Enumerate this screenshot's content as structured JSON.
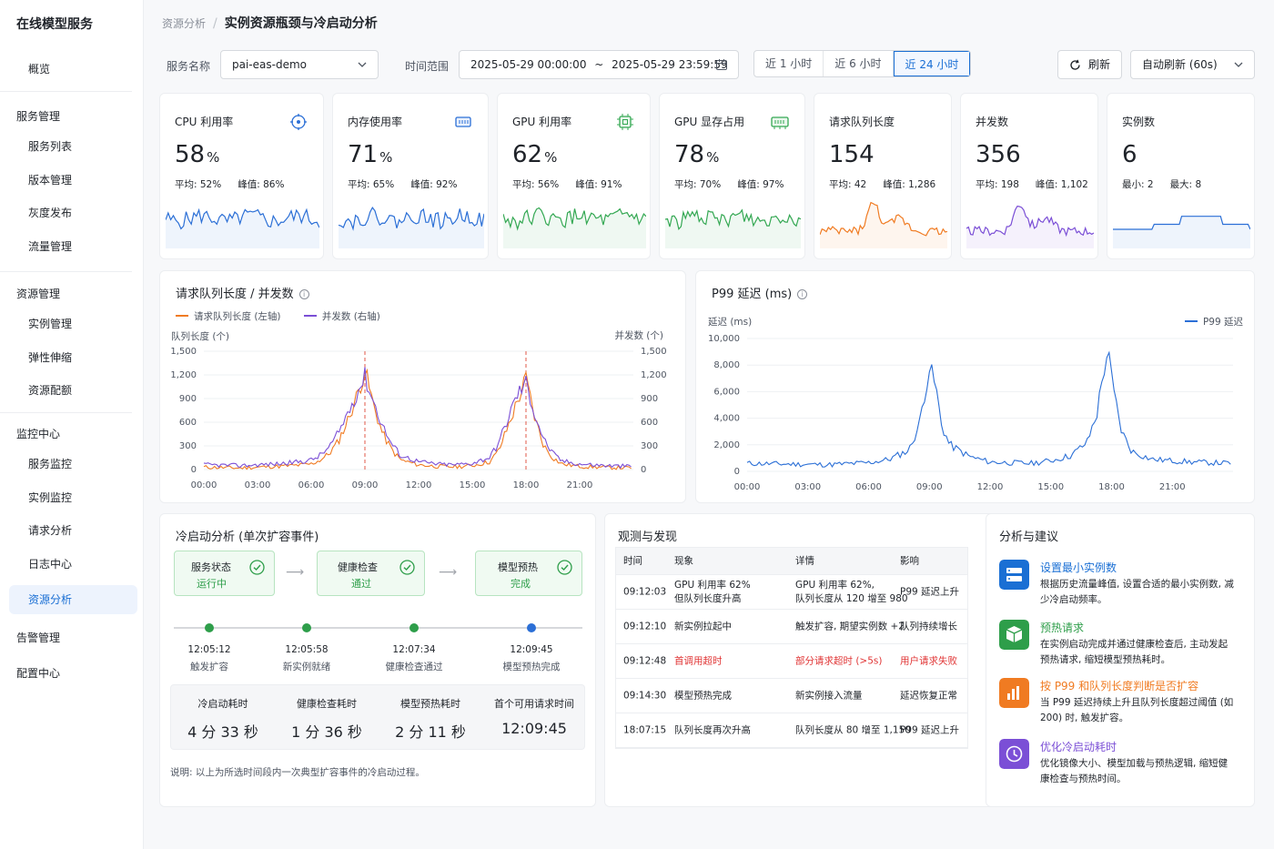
{
  "app": {
    "title": "在线模型服务"
  },
  "nav": {
    "overview": "概览",
    "g1": "服务管理",
    "g1_items": [
      "服务列表",
      "版本管理",
      "灰度发布",
      "流量管理"
    ],
    "g2": "资源管理",
    "g2_items": [
      "实例管理",
      "弹性伸缩",
      "资源配额"
    ],
    "g3": "监控中心",
    "g3_items": [
      "服务监控",
      "实例监控",
      "请求分析",
      "日志中心",
      "资源分析"
    ],
    "g4": "告警管理",
    "g5": "配置中心"
  },
  "breadcrumb": {
    "parent": "资源分析",
    "sep": "/",
    "current": "实例资源瓶颈与冷启动分析"
  },
  "filters": {
    "service_label": "服务名称",
    "service_value": "pai-eas-demo",
    "time_label": "时间范围",
    "time_start": "2025-05-29 00:00:00",
    "time_sep": "~",
    "time_end": "2025-05-29 23:59:59",
    "quick": [
      "近 1 小时",
      "近 6 小时",
      "近 24 小时"
    ],
    "quick_active": "近 24 小时",
    "refresh": "刷新",
    "auto_refresh": "自动刷新 (60s)"
  },
  "kpis": [
    {
      "title": "CPU 利用率",
      "value": "58",
      "unit": "%",
      "s1": "平均: 52%",
      "s2": "峰值: 86%",
      "color": "#2b6fd6",
      "icon": "target-icon"
    },
    {
      "title": "内存使用率",
      "value": "71",
      "unit": "%",
      "s1": "平均: 65%",
      "s2": "峰值: 92%",
      "color": "#2b6fd6",
      "icon": "memory-icon"
    },
    {
      "title": "GPU 利用率",
      "value": "62",
      "unit": "%",
      "s1": "平均: 56%",
      "s2": "峰值: 91%",
      "color": "#34a853",
      "icon": "chip-icon"
    },
    {
      "title": "GPU 显存占用",
      "value": "78",
      "unit": "%",
      "s1": "平均: 70%",
      "s2": "峰值: 97%",
      "color": "#34a853",
      "icon": "gpu-memory-icon"
    },
    {
      "title": "请求队列长度",
      "value": "154",
      "unit": "",
      "s1": "平均: 42",
      "s2": "峰值: 1,286",
      "color": "#f07b22",
      "icon": ""
    },
    {
      "title": "并发数",
      "value": "356",
      "unit": "",
      "s1": "平均: 198",
      "s2": "峰值: 1,102",
      "color": "#7b4fd6",
      "icon": ""
    },
    {
      "title": "实例数",
      "value": "6",
      "unit": "",
      "s1": "最小: 2",
      "s2": "最大: 8",
      "color": "#2b6fd6",
      "icon": ""
    }
  ],
  "queue_chart": {
    "title": "请求队列长度 / 并发数",
    "left_label": "队列长度 (个)",
    "right_label": "并发数 (个)"
  },
  "p99_chart": {
    "title": "P99 延迟 (ms)",
    "ylabel": "延迟 (ms)"
  },
  "chart_data": [
    {
      "type": "line",
      "title": "请求队列长度 / 并发数",
      "ylabel": "队列长度 (个)",
      "y2label": "并发数 (个)",
      "x": [
        "00:00",
        "03:00",
        "06:00",
        "09:00",
        "12:00",
        "15:00",
        "18:00",
        "21:00"
      ],
      "yticks": [
        "0",
        "300",
        "600",
        "900",
        "1,200",
        "1,500"
      ],
      "ylim": [
        0,
        1500
      ],
      "y2lim": [
        0,
        1500
      ],
      "series": [
        {
          "name": "请求队列长度 (左轴)",
          "color": "#f07b22",
          "points": [
            [
              0,
              30
            ],
            [
              1,
              25
            ],
            [
              2,
              20
            ],
            [
              3,
              30
            ],
            [
              4,
              40
            ],
            [
              5,
              50
            ],
            [
              6,
              70
            ],
            [
              6.5,
              120
            ],
            [
              7,
              200
            ],
            [
              7.5,
              350
            ],
            [
              8,
              600
            ],
            [
              8.5,
              900
            ],
            [
              9,
              1250
            ],
            [
              9.5,
              800
            ],
            [
              10,
              450
            ],
            [
              10.5,
              250
            ],
            [
              11,
              120
            ],
            [
              12,
              60
            ],
            [
              13,
              40
            ],
            [
              14,
              35
            ],
            [
              15,
              50
            ],
            [
              16,
              100
            ],
            [
              16.5,
              250
            ],
            [
              17,
              550
            ],
            [
              17.5,
              850
            ],
            [
              18,
              1150
            ],
            [
              18.5,
              650
            ],
            [
              19,
              300
            ],
            [
              19.5,
              150
            ],
            [
              20,
              70
            ],
            [
              21,
              40
            ],
            [
              22,
              30
            ],
            [
              23,
              25
            ],
            [
              24,
              20
            ]
          ]
        },
        {
          "name": "并发数 (右轴)",
          "color": "#7b4fd6",
          "points": [
            [
              0,
              60
            ],
            [
              1,
              55
            ],
            [
              2,
              50
            ],
            [
              3,
              60
            ],
            [
              4,
              70
            ],
            [
              5,
              90
            ],
            [
              6,
              120
            ],
            [
              6.5,
              180
            ],
            [
              7,
              280
            ],
            [
              7.5,
              450
            ],
            [
              8,
              700
            ],
            [
              8.5,
              950
            ],
            [
              9,
              1180
            ],
            [
              9.5,
              850
            ],
            [
              10,
              550
            ],
            [
              10.5,
              320
            ],
            [
              11,
              180
            ],
            [
              12,
              100
            ],
            [
              13,
              70
            ],
            [
              14,
              60
            ],
            [
              15,
              80
            ],
            [
              16,
              160
            ],
            [
              16.5,
              350
            ],
            [
              17,
              650
            ],
            [
              17.5,
              950
            ],
            [
              18,
              1100
            ],
            [
              18.5,
              700
            ],
            [
              19,
              380
            ],
            [
              19.5,
              200
            ],
            [
              20,
              110
            ],
            [
              21,
              70
            ],
            [
              22,
              55
            ],
            [
              23,
              45
            ],
            [
              24,
              40
            ]
          ]
        }
      ],
      "markers": [
        "09:00",
        "18:00"
      ]
    },
    {
      "type": "line",
      "title": "P99 延迟 (ms)",
      "ylabel": "延迟 (ms)",
      "x": [
        "00:00",
        "03:00",
        "06:00",
        "09:00",
        "12:00",
        "15:00",
        "18:00",
        "21:00"
      ],
      "yticks": [
        "0",
        "2,000",
        "4,000",
        "6,000",
        "8,000",
        "10,000"
      ],
      "ylim": [
        0,
        10000
      ],
      "series": [
        {
          "name": "P99 延迟",
          "color": "#2b6fd6",
          "points": [
            [
              0,
              600
            ],
            [
              2,
              550
            ],
            [
              4,
              500
            ],
            [
              6,
              650
            ],
            [
              7,
              900
            ],
            [
              8,
              1600
            ],
            [
              8.5,
              3500
            ],
            [
              8.8,
              6200
            ],
            [
              9,
              7800
            ],
            [
              9.3,
              6500
            ],
            [
              9.6,
              3500
            ],
            [
              10,
              2000
            ],
            [
              11,
              1100
            ],
            [
              12,
              700
            ],
            [
              14,
              600
            ],
            [
              15,
              800
            ],
            [
              16,
              1200
            ],
            [
              16.8,
              2200
            ],
            [
              17.3,
              4500
            ],
            [
              17.6,
              7500
            ],
            [
              17.8,
              9100
            ],
            [
              18.1,
              6000
            ],
            [
              18.5,
              3000
            ],
            [
              19,
              1500
            ],
            [
              20,
              900
            ],
            [
              22,
              700
            ],
            [
              24,
              600
            ]
          ]
        }
      ]
    }
  ],
  "cold_start": {
    "title": "冷启动分析 (单次扩容事件)",
    "stages": [
      {
        "name": "服务状态",
        "status": "运行中"
      },
      {
        "name": "健康检查",
        "status": "通过"
      },
      {
        "name": "模型预热",
        "status": "完成"
      }
    ],
    "timeline": [
      {
        "time": "12:05:12",
        "label": "触发扩容"
      },
      {
        "time": "12:05:58",
        "label": "新实例就绪"
      },
      {
        "time": "12:07:34",
        "label": "健康检查通过"
      },
      {
        "time": "12:09:45",
        "label": "模型预热完成"
      }
    ],
    "summary": [
      {
        "h": "冷启动耗时",
        "v": "4 分 33 秒"
      },
      {
        "h": "健康检查耗时",
        "v": "1 分 36 秒"
      },
      {
        "h": "模型预热耗时",
        "v": "2 分 11 秒"
      },
      {
        "h": "首个可用请求时间",
        "v": "12:09:45"
      }
    ],
    "note": "说明: 以上为所选时间段内一次典型扩容事件的冷启动过程。"
  },
  "findings": {
    "title": "观测与发现",
    "headers": [
      "时间",
      "现象",
      "详情",
      "影响"
    ],
    "rows": [
      {
        "t": "09:12:03",
        "p": [
          "GPU 利用率 62%",
          "但队列长度升高"
        ],
        "d": [
          "GPU 利用率 62%,",
          "队列长度从 120 增至 980"
        ],
        "i": "P99 延迟上升",
        "red": false
      },
      {
        "t": "09:12:10",
        "p": [
          "新实例拉起中"
        ],
        "d": [
          "触发扩容, 期望实例数 +2"
        ],
        "i": "队列持续增长",
        "red": false
      },
      {
        "t": "09:12:48",
        "p": [
          "首调用超时"
        ],
        "d": [
          "部分请求超时 (>5s)"
        ],
        "i": "用户请求失败",
        "red": true
      },
      {
        "t": "09:14:30",
        "p": [
          "模型预热完成"
        ],
        "d": [
          "新实例接入流量"
        ],
        "i": "延迟恢复正常",
        "red": false
      },
      {
        "t": "18:07:15",
        "p": [
          "队列长度再次升高"
        ],
        "d": [
          "队列长度从 80 增至 1,150"
        ],
        "i": "P99 延迟上升",
        "red": false
      }
    ]
  },
  "suggestions": {
    "title": "分析与建议",
    "items": [
      {
        "title": "设置最小实例数",
        "desc": "根据历史流量峰值, 设置合适的最小实例数, 减少冷启动频率。",
        "color": "#1a6fd4",
        "icon": "server-icon"
      },
      {
        "title": "预热请求",
        "desc": "在实例启动完成并通过健康检查后, 主动发起预热请求, 缩短模型预热耗时。",
        "color": "#2e9e4a",
        "icon": "cube-icon"
      },
      {
        "title": "按 P99 和队列长度判断是否扩容",
        "desc": "当 P99 延迟持续上升且队列长度超过阈值 (如 200) 时, 触发扩容。",
        "color": "#f07b22",
        "icon": "bar-chart-icon"
      },
      {
        "title": "优化冷启动耗时",
        "desc": "优化镜像大小、模型加载与预热逻辑, 缩短健康检查与预热时间。",
        "color": "#7b4fd6",
        "icon": "clock-icon"
      }
    ]
  }
}
